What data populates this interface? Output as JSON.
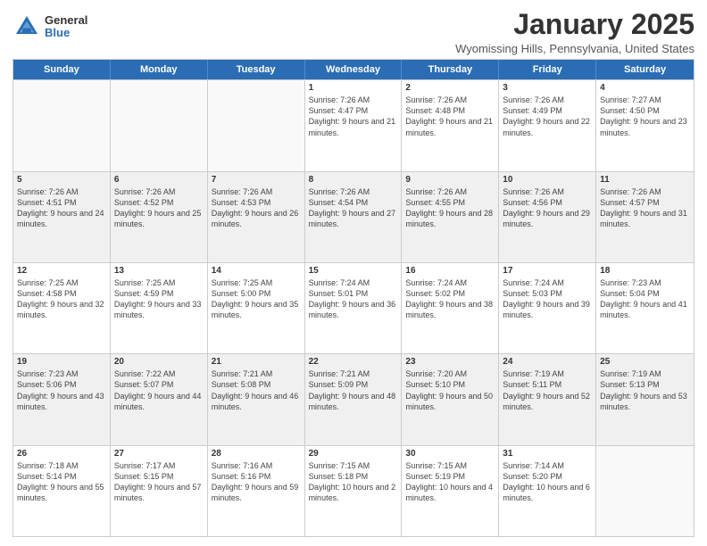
{
  "header": {
    "logo_general": "General",
    "logo_blue": "Blue",
    "month_title": "January 2025",
    "location": "Wyomissing Hills, Pennsylvania, United States"
  },
  "days_of_week": [
    "Sunday",
    "Monday",
    "Tuesday",
    "Wednesday",
    "Thursday",
    "Friday",
    "Saturday"
  ],
  "weeks": [
    [
      {
        "day": "",
        "info": "",
        "empty": true
      },
      {
        "day": "",
        "info": "",
        "empty": true
      },
      {
        "day": "",
        "info": "",
        "empty": true
      },
      {
        "day": "1",
        "info": "Sunrise: 7:26 AM\nSunset: 4:47 PM\nDaylight: 9 hours and 21 minutes."
      },
      {
        "day": "2",
        "info": "Sunrise: 7:26 AM\nSunset: 4:48 PM\nDaylight: 9 hours and 21 minutes."
      },
      {
        "day": "3",
        "info": "Sunrise: 7:26 AM\nSunset: 4:49 PM\nDaylight: 9 hours and 22 minutes."
      },
      {
        "day": "4",
        "info": "Sunrise: 7:27 AM\nSunset: 4:50 PM\nDaylight: 9 hours and 23 minutes."
      }
    ],
    [
      {
        "day": "5",
        "info": "Sunrise: 7:26 AM\nSunset: 4:51 PM\nDaylight: 9 hours and 24 minutes."
      },
      {
        "day": "6",
        "info": "Sunrise: 7:26 AM\nSunset: 4:52 PM\nDaylight: 9 hours and 25 minutes."
      },
      {
        "day": "7",
        "info": "Sunrise: 7:26 AM\nSunset: 4:53 PM\nDaylight: 9 hours and 26 minutes."
      },
      {
        "day": "8",
        "info": "Sunrise: 7:26 AM\nSunset: 4:54 PM\nDaylight: 9 hours and 27 minutes."
      },
      {
        "day": "9",
        "info": "Sunrise: 7:26 AM\nSunset: 4:55 PM\nDaylight: 9 hours and 28 minutes."
      },
      {
        "day": "10",
        "info": "Sunrise: 7:26 AM\nSunset: 4:56 PM\nDaylight: 9 hours and 29 minutes."
      },
      {
        "day": "11",
        "info": "Sunrise: 7:26 AM\nSunset: 4:57 PM\nDaylight: 9 hours and 31 minutes."
      }
    ],
    [
      {
        "day": "12",
        "info": "Sunrise: 7:25 AM\nSunset: 4:58 PM\nDaylight: 9 hours and 32 minutes."
      },
      {
        "day": "13",
        "info": "Sunrise: 7:25 AM\nSunset: 4:59 PM\nDaylight: 9 hours and 33 minutes."
      },
      {
        "day": "14",
        "info": "Sunrise: 7:25 AM\nSunset: 5:00 PM\nDaylight: 9 hours and 35 minutes."
      },
      {
        "day": "15",
        "info": "Sunrise: 7:24 AM\nSunset: 5:01 PM\nDaylight: 9 hours and 36 minutes."
      },
      {
        "day": "16",
        "info": "Sunrise: 7:24 AM\nSunset: 5:02 PM\nDaylight: 9 hours and 38 minutes."
      },
      {
        "day": "17",
        "info": "Sunrise: 7:24 AM\nSunset: 5:03 PM\nDaylight: 9 hours and 39 minutes."
      },
      {
        "day": "18",
        "info": "Sunrise: 7:23 AM\nSunset: 5:04 PM\nDaylight: 9 hours and 41 minutes."
      }
    ],
    [
      {
        "day": "19",
        "info": "Sunrise: 7:23 AM\nSunset: 5:06 PM\nDaylight: 9 hours and 43 minutes."
      },
      {
        "day": "20",
        "info": "Sunrise: 7:22 AM\nSunset: 5:07 PM\nDaylight: 9 hours and 44 minutes."
      },
      {
        "day": "21",
        "info": "Sunrise: 7:21 AM\nSunset: 5:08 PM\nDaylight: 9 hours and 46 minutes."
      },
      {
        "day": "22",
        "info": "Sunrise: 7:21 AM\nSunset: 5:09 PM\nDaylight: 9 hours and 48 minutes."
      },
      {
        "day": "23",
        "info": "Sunrise: 7:20 AM\nSunset: 5:10 PM\nDaylight: 9 hours and 50 minutes."
      },
      {
        "day": "24",
        "info": "Sunrise: 7:19 AM\nSunset: 5:11 PM\nDaylight: 9 hours and 52 minutes."
      },
      {
        "day": "25",
        "info": "Sunrise: 7:19 AM\nSunset: 5:13 PM\nDaylight: 9 hours and 53 minutes."
      }
    ],
    [
      {
        "day": "26",
        "info": "Sunrise: 7:18 AM\nSunset: 5:14 PM\nDaylight: 9 hours and 55 minutes."
      },
      {
        "day": "27",
        "info": "Sunrise: 7:17 AM\nSunset: 5:15 PM\nDaylight: 9 hours and 57 minutes."
      },
      {
        "day": "28",
        "info": "Sunrise: 7:16 AM\nSunset: 5:16 PM\nDaylight: 9 hours and 59 minutes."
      },
      {
        "day": "29",
        "info": "Sunrise: 7:15 AM\nSunset: 5:18 PM\nDaylight: 10 hours and 2 minutes."
      },
      {
        "day": "30",
        "info": "Sunrise: 7:15 AM\nSunset: 5:19 PM\nDaylight: 10 hours and 4 minutes."
      },
      {
        "day": "31",
        "info": "Sunrise: 7:14 AM\nSunset: 5:20 PM\nDaylight: 10 hours and 6 minutes."
      },
      {
        "day": "",
        "info": "",
        "empty": true
      }
    ]
  ]
}
